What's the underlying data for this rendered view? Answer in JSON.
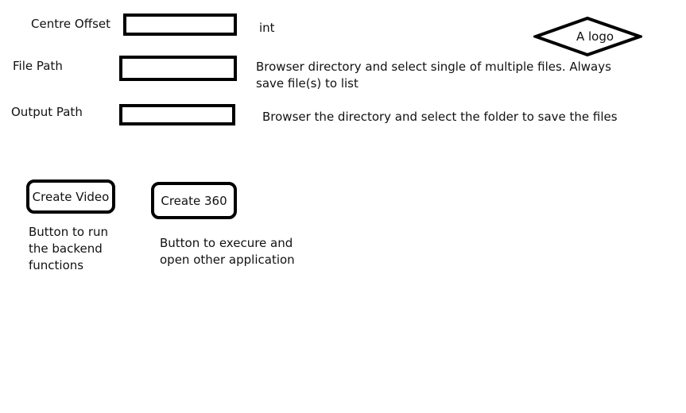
{
  "form": {
    "centre_offset": {
      "label": "Centre Offset",
      "value": "",
      "hint": "int"
    },
    "file_path": {
      "label": "File Path",
      "value": "",
      "hint": "Browser directory and select single of multiple files. Always save file(s) to list"
    },
    "output_path": {
      "label": "Output Path",
      "value": "",
      "hint": "Browser the directory and select the folder to save the files"
    }
  },
  "buttons": {
    "create_video": {
      "label": "Create Video",
      "note": "Button to run the backend functions"
    },
    "create_360": {
      "label": "Create 360",
      "note": "Button to execure and open other application"
    }
  },
  "logo": {
    "text": "A logo",
    "icon": "diamond-logo-icon"
  }
}
